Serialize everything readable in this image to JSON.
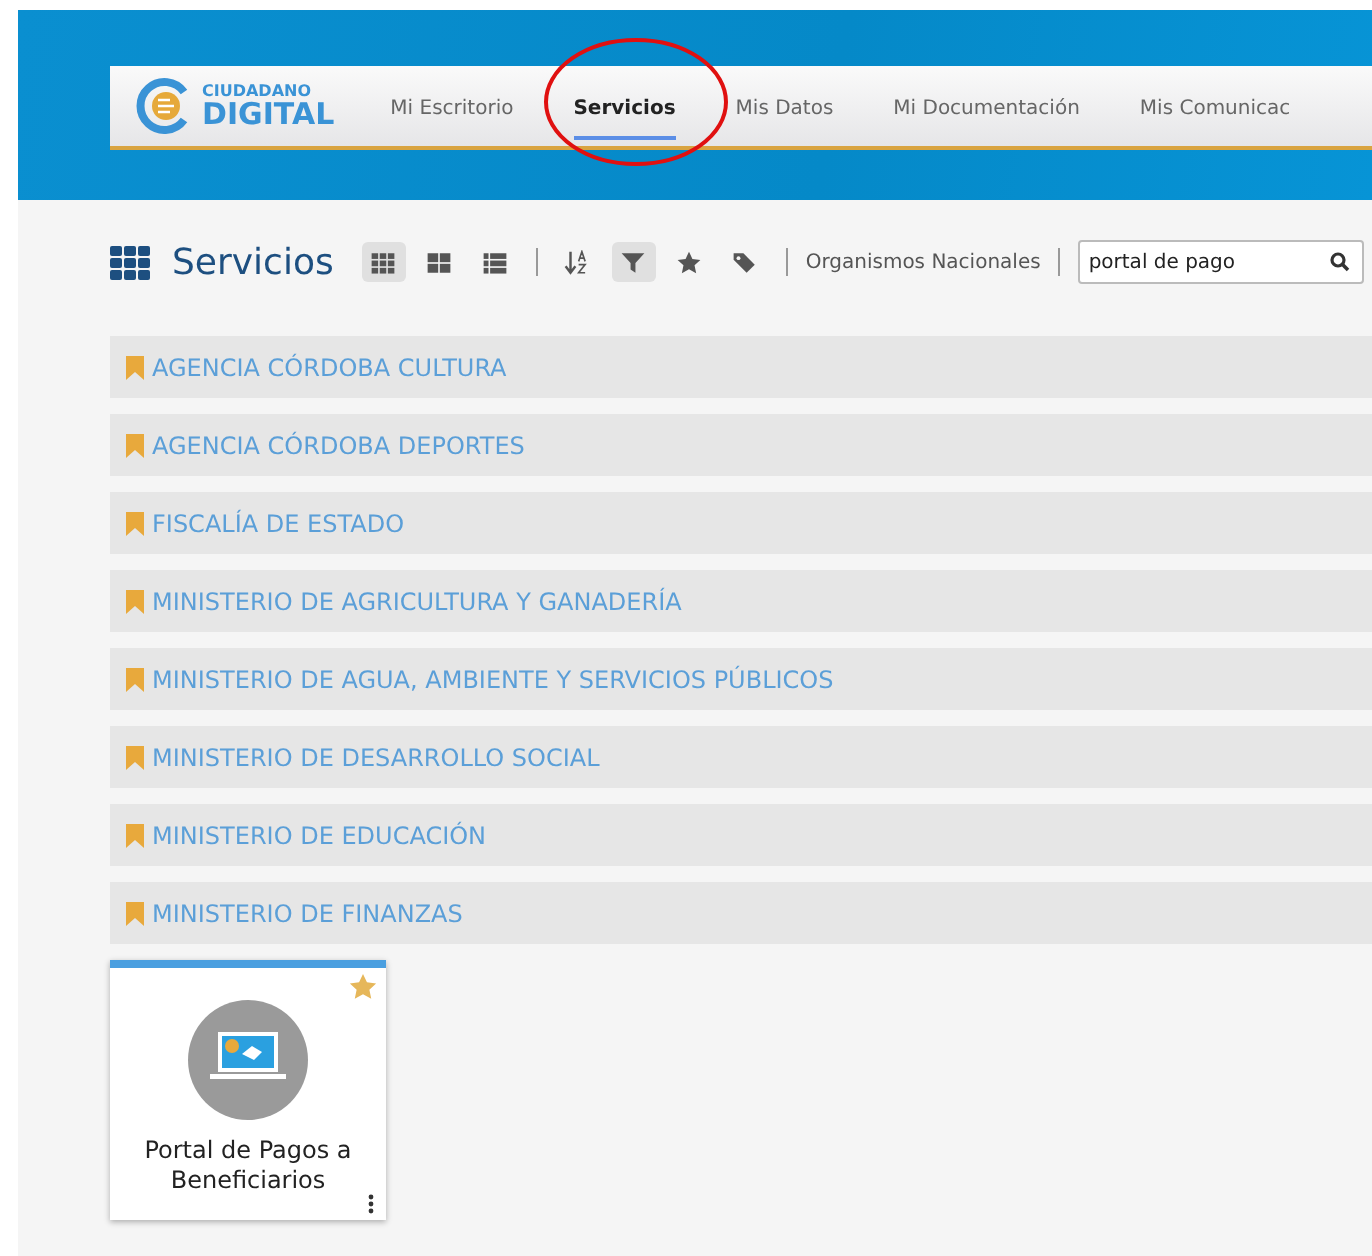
{
  "nav": {
    "logo_top": "CIUDADANO",
    "logo_bottom": "DIGITAL",
    "items": [
      {
        "label": "Mi Escritorio",
        "selected": false
      },
      {
        "label": "Servicios",
        "selected": true
      },
      {
        "label": "Mis Datos",
        "selected": false
      },
      {
        "label": "Mi Documentación",
        "selected": false
      },
      {
        "label": "Mis Comunicac",
        "selected": false
      }
    ]
  },
  "title": "Servicios",
  "view_modes": [
    {
      "kind": "small",
      "selected": true
    },
    {
      "kind": "large",
      "selected": false
    },
    {
      "kind": "list",
      "selected": false
    }
  ],
  "tools": [
    {
      "kind": "sort",
      "selected": false
    },
    {
      "kind": "filter",
      "selected": true
    },
    {
      "kind": "favorites",
      "selected": false
    },
    {
      "kind": "tags",
      "selected": false
    }
  ],
  "scope_link": "Organismos Nacionales",
  "search": {
    "value": "portal de pago"
  },
  "groups": [
    "AGENCIA CÓRDOBA CULTURA",
    "AGENCIA CÓRDOBA DEPORTES",
    "FISCALÍA DE ESTADO",
    "MINISTERIO DE AGRICULTURA Y GANADERÍA",
    "MINISTERIO DE AGUA, AMBIENTE Y SERVICIOS PÚBLICOS",
    "MINISTERIO DE DESARROLLO SOCIAL",
    "MINISTERIO DE EDUCACIÓN",
    "MINISTERIO DE FINANZAS"
  ],
  "cards": [
    {
      "title": "Portal de Pagos a Beneficiarios",
      "favorite": true
    }
  ]
}
